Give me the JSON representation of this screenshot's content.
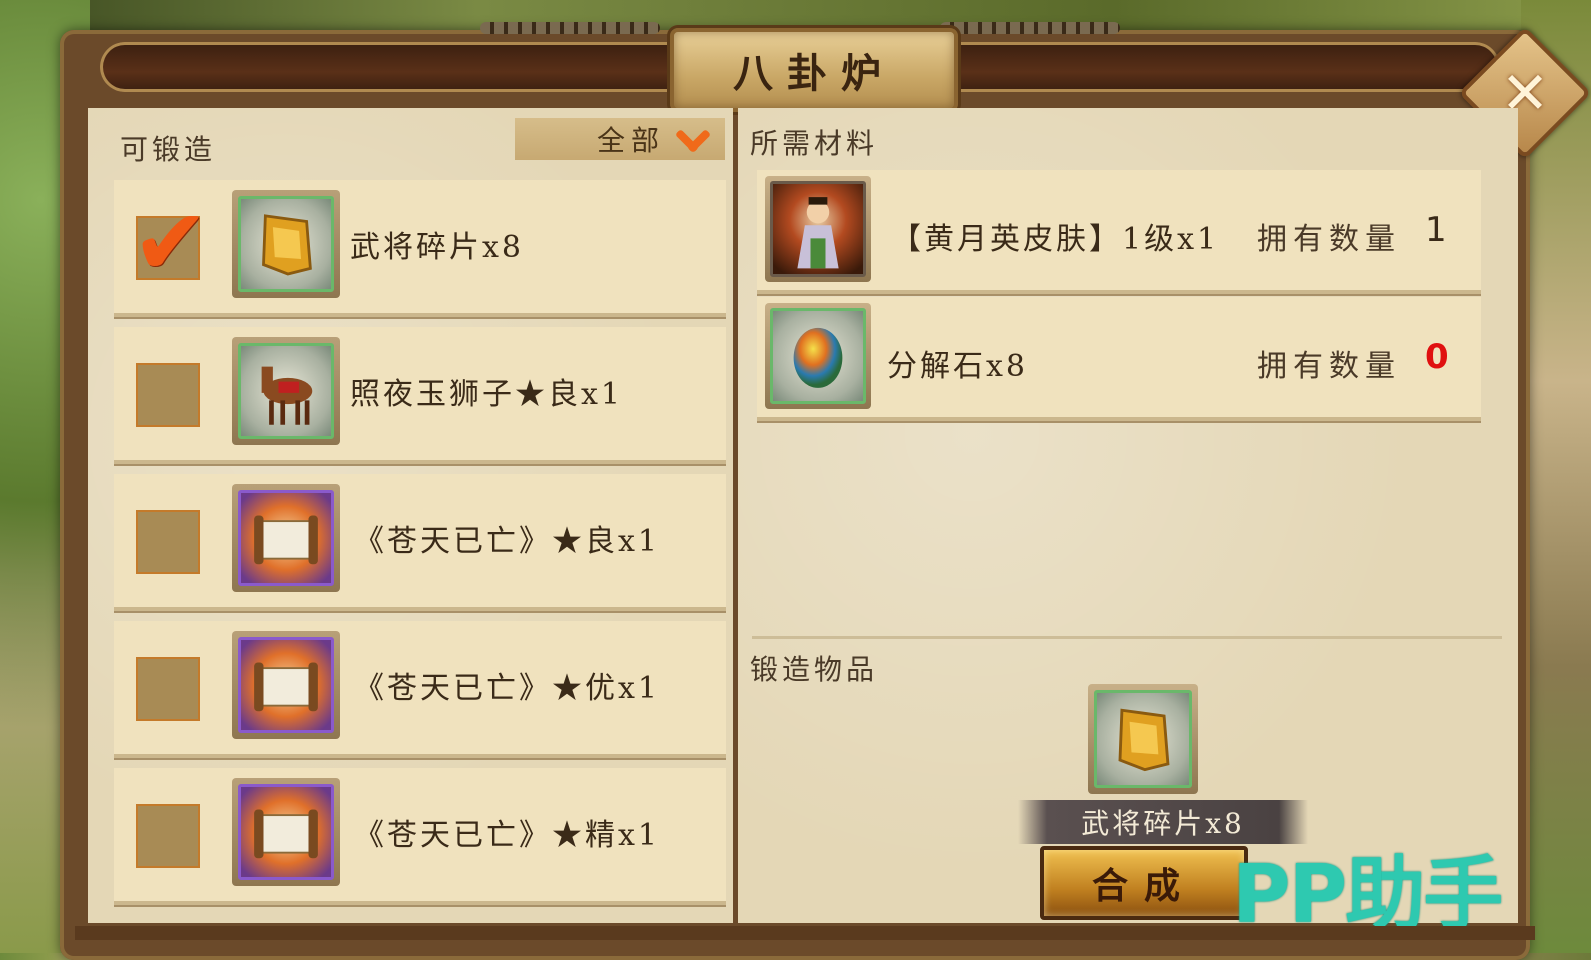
{
  "window": {
    "title": "八卦炉"
  },
  "left_panel": {
    "header": "可锻造",
    "filter": {
      "selected": "全部"
    },
    "items": [
      {
        "name": "武将碎片x8",
        "checked": true,
        "icon": "general-fragment-icon",
        "frame": "green"
      },
      {
        "name": "照夜玉狮子★良x1",
        "checked": false,
        "icon": "horse-icon",
        "frame": "green"
      },
      {
        "name": "《苍天已亡》★良x1",
        "checked": false,
        "icon": "scroll-icon",
        "frame": "purple"
      },
      {
        "name": "《苍天已亡》★优x1",
        "checked": false,
        "icon": "scroll-icon",
        "frame": "purple"
      },
      {
        "name": "《苍天已亡》★精x1",
        "checked": false,
        "icon": "scroll-icon",
        "frame": "purple"
      }
    ]
  },
  "right_panel": {
    "materials_header": "所需材料",
    "materials": [
      {
        "name": "【黄月英皮肤】1级x1",
        "own_label": "拥有数量",
        "own_count": "1",
        "icon": "hero-portrait-icon",
        "insufficient": false
      },
      {
        "name": "分解石x8",
        "own_label": "拥有数量",
        "own_count": "0",
        "icon": "decompose-stone-icon",
        "insufficient": true
      }
    ],
    "result_header": "锻造物品",
    "result": {
      "name": "武将碎片x8",
      "icon": "general-fragment-icon"
    },
    "compose_button": "合成"
  },
  "watermark": "PP助手",
  "colors": {
    "accent": "#f05a14",
    "insufficient": "#e01010",
    "watermark": "#2ec9b0"
  }
}
